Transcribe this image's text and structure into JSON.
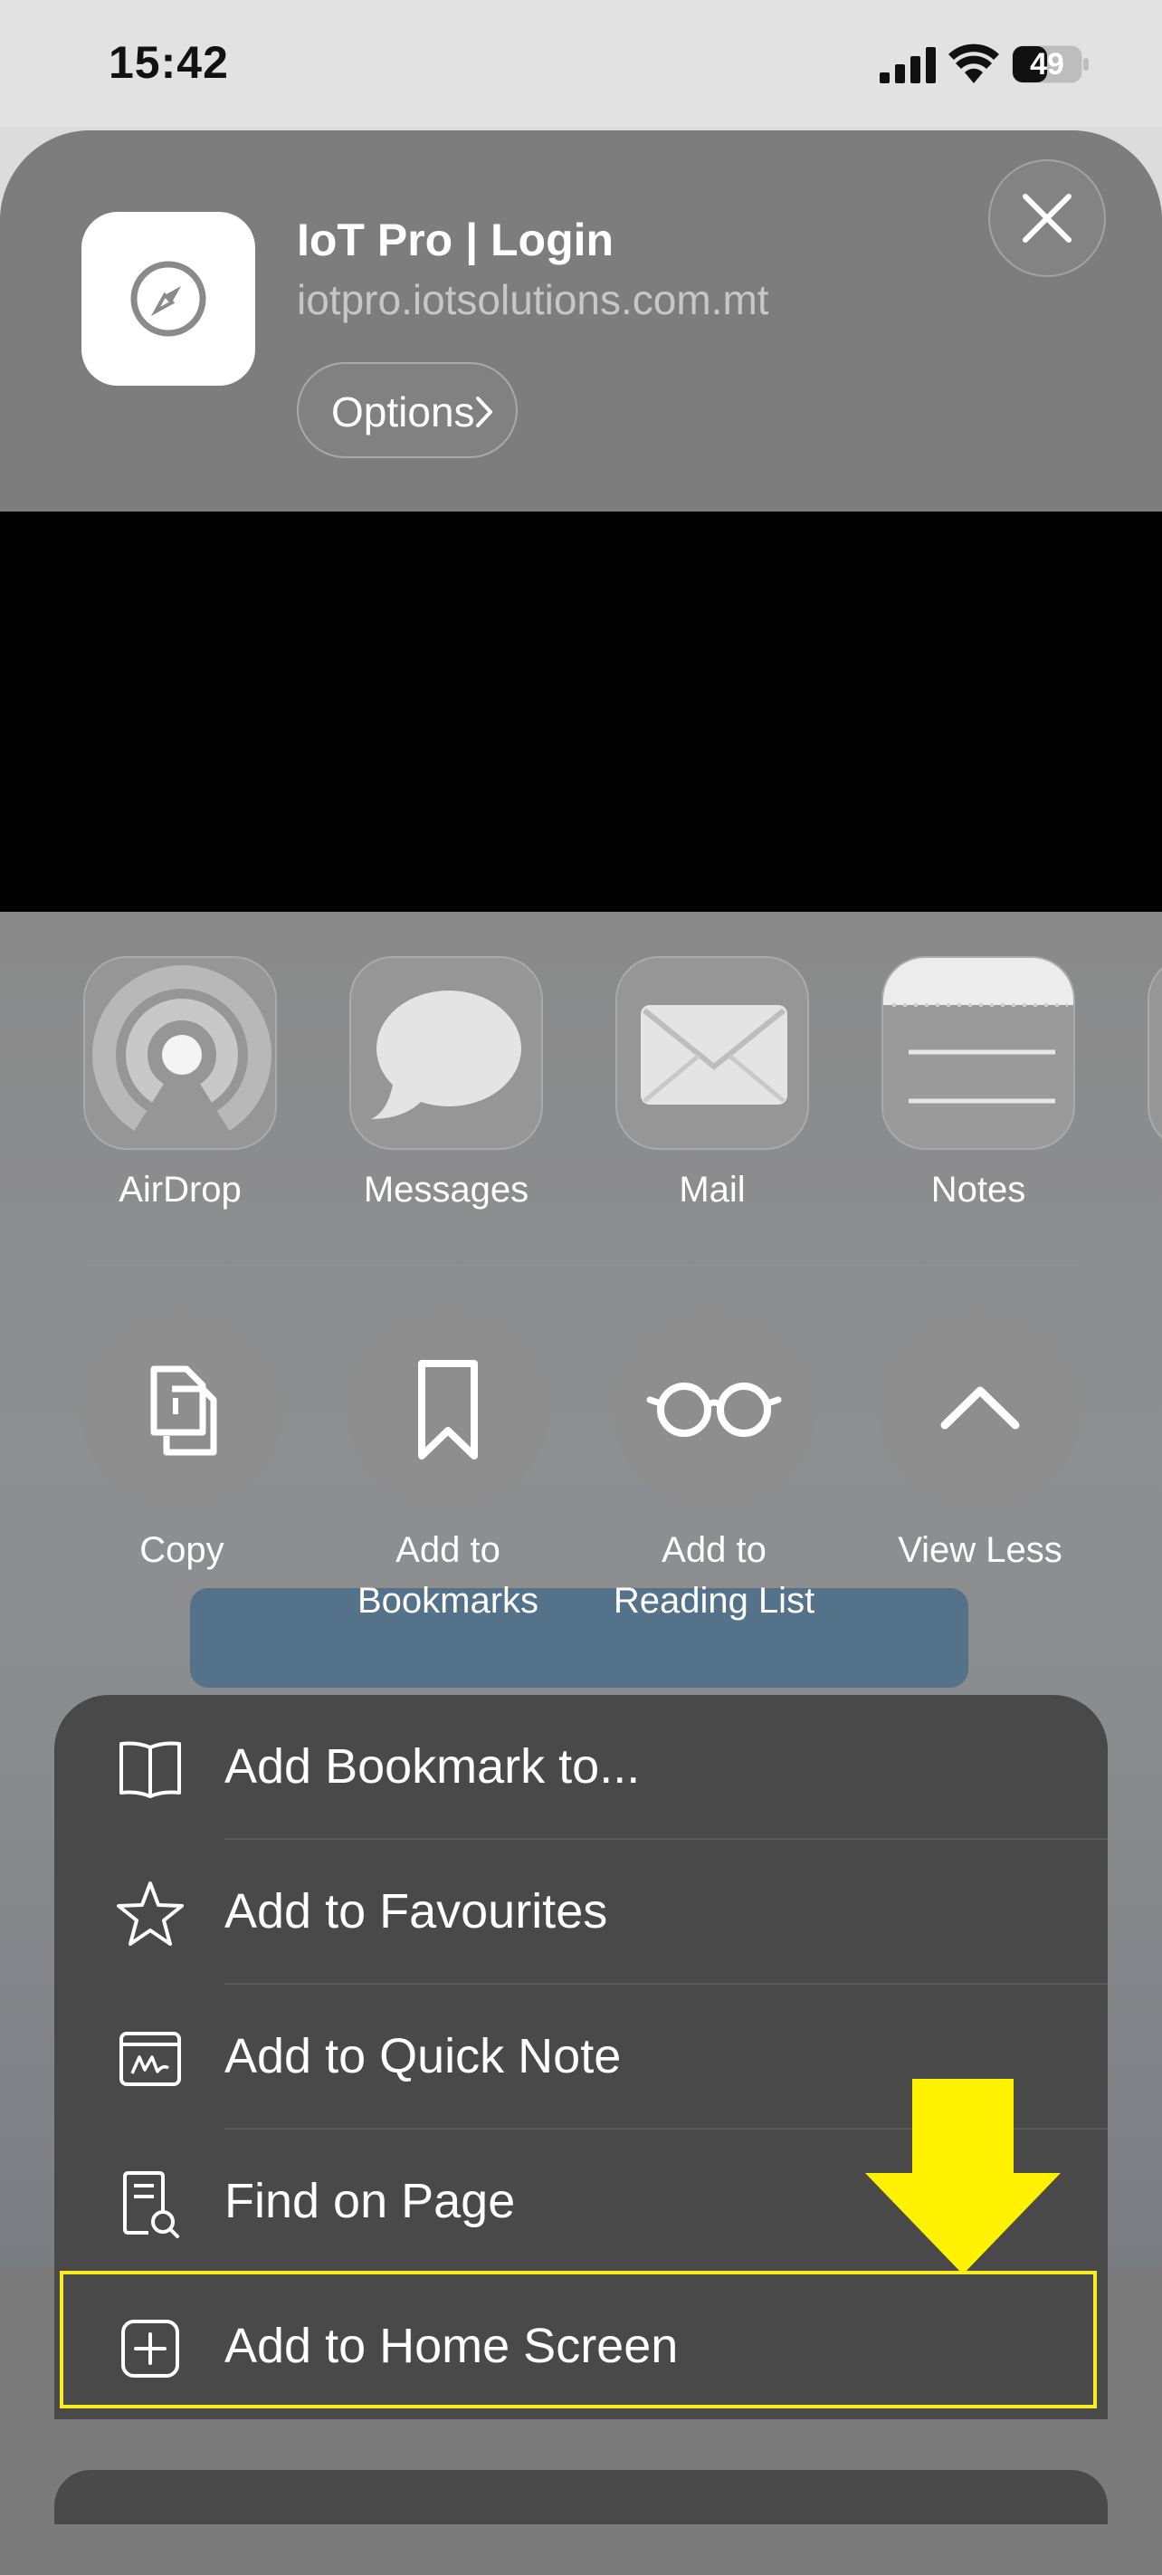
{
  "status_bar": {
    "time": "15:42",
    "battery": "49"
  },
  "header": {
    "title": "IoT Pro | Login",
    "url": "iotpro.iotsolutions.com.mt",
    "options_label": "Options"
  },
  "share_targets": [
    {
      "label": "AirDrop",
      "icon": "airdrop-icon"
    },
    {
      "label": "Messages",
      "icon": "messages-icon"
    },
    {
      "label": "Mail",
      "icon": "mail-icon"
    },
    {
      "label": "Notes",
      "icon": "notes-icon"
    }
  ],
  "actions": [
    {
      "line1": "Copy",
      "line2": "",
      "icon": "copy-icon"
    },
    {
      "line1": "Add to",
      "line2": "Bookmarks",
      "icon": "bookmark-icon"
    },
    {
      "line1": "Add to",
      "line2": "Reading List",
      "icon": "glasses-icon"
    },
    {
      "line1": "View Less",
      "line2": "",
      "icon": "chevron-up-icon"
    }
  ],
  "menu": [
    {
      "label": "Add Bookmark to...",
      "icon": "book-icon"
    },
    {
      "label": "Add to Favourites",
      "icon": "star-icon"
    },
    {
      "label": "Add to Quick Note",
      "icon": "quick-note-icon"
    },
    {
      "label": "Find on Page",
      "icon": "find-on-page-icon"
    },
    {
      "label": "Add to Home Screen",
      "icon": "plus-square-icon"
    }
  ],
  "colors": {
    "highlight": "#f7ec1c",
    "menu_bg": "#494949",
    "sheet_bg": "#7b7b7b"
  }
}
